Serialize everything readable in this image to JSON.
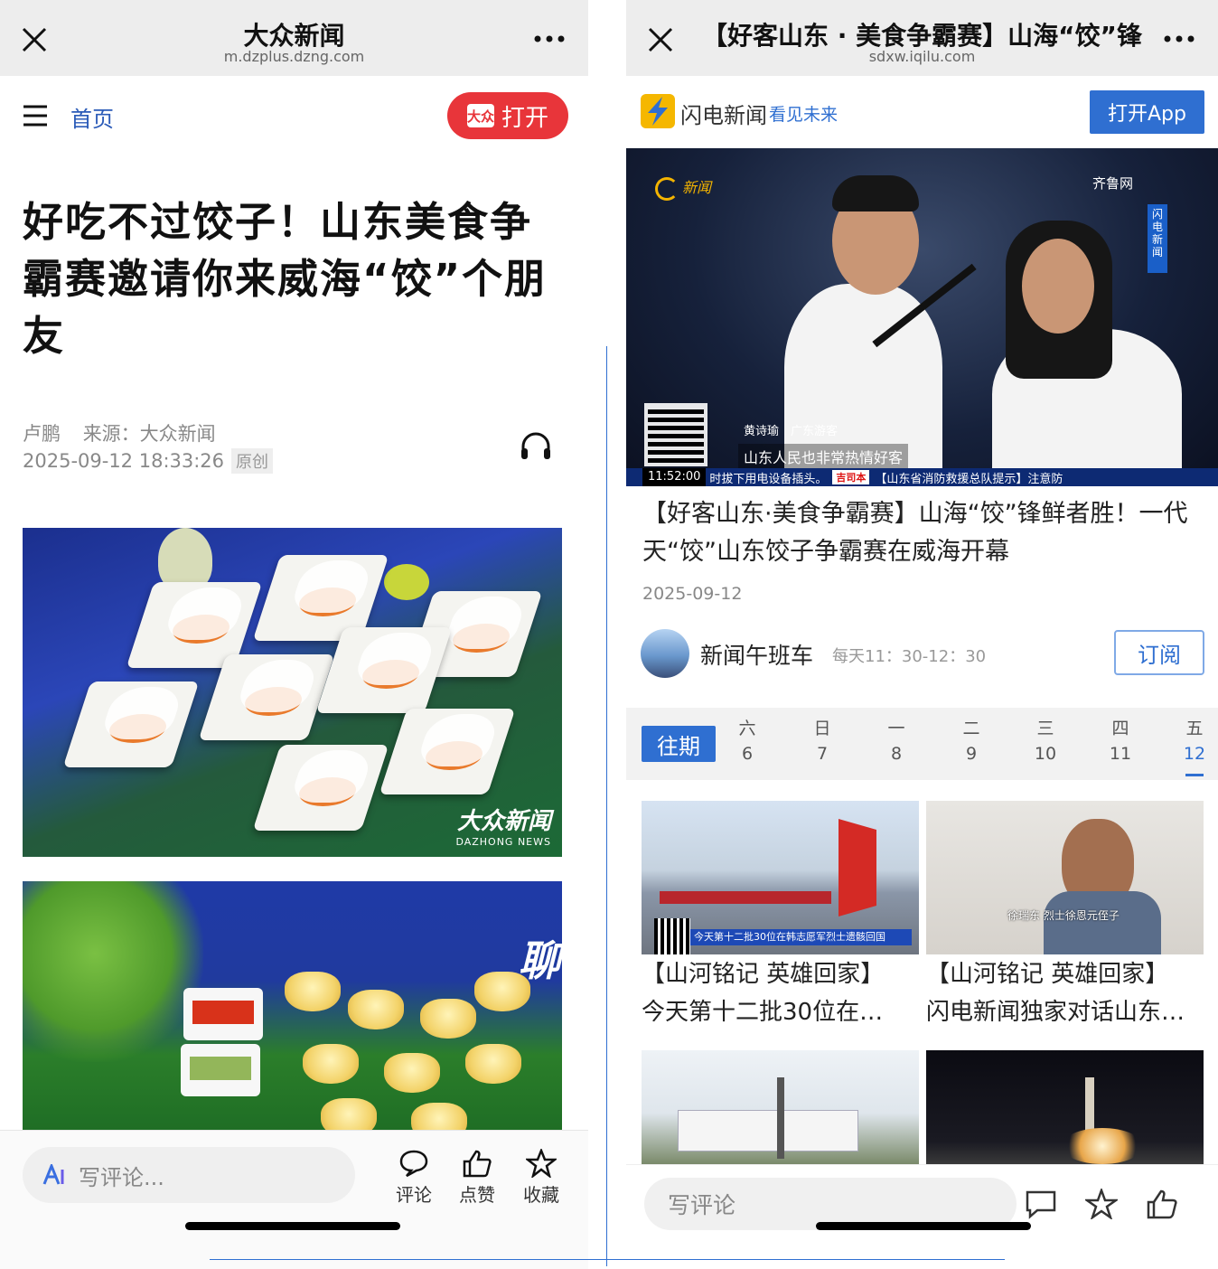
{
  "left": {
    "navbar": {
      "title": "大众新闻",
      "url": "m.dzplus.dzng.com"
    },
    "header": {
      "home_label": "首页",
      "open_label": "打开",
      "open_logo_text": "大众"
    },
    "article": {
      "headline": "好吃不过饺子！山东美食争霸赛邀请你来威海“饺”个朋友",
      "author": "卢鹏",
      "source": "来源：大众新闻",
      "datetime": "2025-09-12 18:33:26",
      "badge": "原创"
    },
    "photo1": {
      "watermark_main": "大众新闻",
      "watermark_sub": "DAZHONG NEWS"
    },
    "photo2": {
      "brand_text": "聊"
    },
    "bottom_bar": {
      "comment_placeholder": "写评论...",
      "actions": [
        {
          "label": "评论",
          "icon": "comment-icon"
        },
        {
          "label": "点赞",
          "icon": "thumbs-up-icon"
        },
        {
          "label": "收藏",
          "icon": "star-icon"
        }
      ]
    }
  },
  "right": {
    "navbar": {
      "title": "【好客山东 · 美食争霸赛】山海“饺”锋",
      "url": "sdxw.iqilu.com"
    },
    "brand": {
      "name": "闪电新闻",
      "slogan": "看见未来",
      "open_app_label": "打开App"
    },
    "video": {
      "channel_logo": "新闻",
      "qilu_logo": "齐鲁网",
      "side_tag": "闪电新闻",
      "speaker_name": "黄诗瑜　广东游客",
      "speaker_quote": "山东人民也非常热情好客",
      "ticker_time": "11:52:00",
      "ticker_left": "时拔下用电设备插头。",
      "ticker_brand": "吉司本",
      "ticker_right": "【山东省消防救援总队提示】注意防"
    },
    "article": {
      "title": "【好客山东·美食争霸赛】山海“饺”锋鲜者胜！一代天“饺”山东饺子争霸赛在威海开幕",
      "date": "2025-09-12"
    },
    "channel": {
      "name": "新闻午班车",
      "schedule": "每天11：30-12：30",
      "subscribe_label": "订阅"
    },
    "date_strip": {
      "past_label": "往期",
      "days": [
        {
          "weekday": "六",
          "date": "6"
        },
        {
          "weekday": "日",
          "date": "7"
        },
        {
          "weekday": "一",
          "date": "8"
        },
        {
          "weekday": "二",
          "date": "9"
        },
        {
          "weekday": "三",
          "date": "10"
        },
        {
          "weekday": "四",
          "date": "11"
        },
        {
          "weekday": "五",
          "date": "12"
        }
      ],
      "active_index": 6
    },
    "cards": [
      {
        "title_line1": "【山河铭记 英雄回家】",
        "title_line2": "今天第十二批30位在…",
        "caption": "今天第十二批30位在韩志愿军烈士遗骸回国"
      },
      {
        "title_line1": "【山河铭记 英雄回家】",
        "title_line2": "闪电新闻独家对话山东…",
        "caption": "徐瑞东 烈士徐恩元侄子"
      },
      {
        "title_line1": "",
        "title_line2": "",
        "caption": ""
      },
      {
        "title_line1": "",
        "title_line2": "",
        "caption": ""
      }
    ],
    "bottom_bar": {
      "comment_placeholder": "写评论"
    }
  },
  "colors": {
    "accent_red": "#e8353a",
    "accent_blue": "#2f6fd1",
    "navbar_bg": "#ededed"
  }
}
